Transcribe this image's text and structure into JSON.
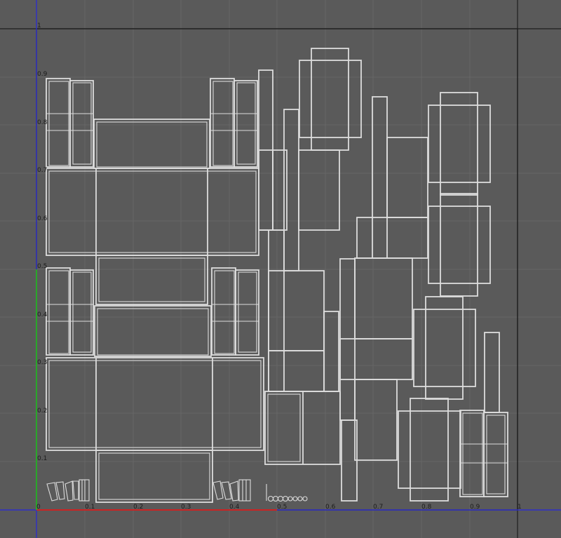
{
  "viewport": {
    "title": "",
    "colors": {
      "background": "#5a5a5a",
      "grid": "#666666",
      "border": "#1e1e1e",
      "u_axis": "#cc2222",
      "v_axis": "#2e2ec8",
      "v_axis_positive": "#2aa62a",
      "uv_lines": "#dcdcdc"
    },
    "u_ticks": [
      "0",
      "0.1",
      "0.2",
      "0.3",
      "0.4",
      "0.5",
      "0.6",
      "0.7",
      "0.8",
      "0.9",
      "1"
    ],
    "v_ticks": [
      "0.1",
      "0.2",
      "0.3",
      "0.4",
      "0.5",
      "0.6",
      "0.7",
      "0.8",
      "0.9",
      "1"
    ]
  }
}
